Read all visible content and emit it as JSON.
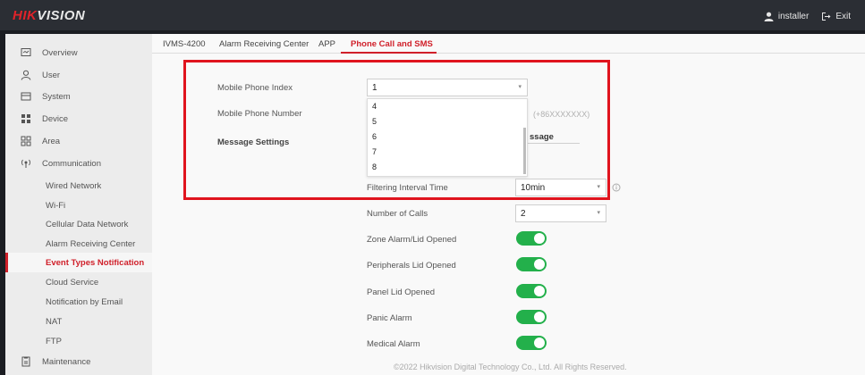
{
  "header": {
    "logo_part1": "HIK",
    "logo_part2": "VISION",
    "user_label": "installer",
    "exit_label": "Exit"
  },
  "sidebar": {
    "items": [
      {
        "label": "Overview",
        "icon": "overview-icon"
      },
      {
        "label": "User",
        "icon": "user-icon"
      },
      {
        "label": "System",
        "icon": "system-icon"
      },
      {
        "label": "Device",
        "icon": "device-icon"
      },
      {
        "label": "Area",
        "icon": "area-icon"
      },
      {
        "label": "Communication",
        "icon": "communication-icon"
      }
    ],
    "sub_items": [
      {
        "label": "Wired Network"
      },
      {
        "label": "Wi-Fi"
      },
      {
        "label": "Cellular Data Network"
      },
      {
        "label": "Alarm Receiving Center"
      },
      {
        "label": "Event Types Notification",
        "active": true
      },
      {
        "label": "Cloud Service"
      },
      {
        "label": "Notification by Email"
      },
      {
        "label": "NAT"
      },
      {
        "label": "FTP"
      }
    ],
    "maintenance": {
      "label": "Maintenance",
      "icon": "maintenance-icon"
    }
  },
  "tabs": [
    {
      "label": "IVMS-4200"
    },
    {
      "label": "Alarm Receiving Center"
    },
    {
      "label": "APP"
    },
    {
      "label": "Phone Call and SMS",
      "active": true
    }
  ],
  "form": {
    "mobile_phone_index_label": "Mobile Phone Index",
    "mobile_phone_index_value": "1",
    "mobile_phone_number_label": "Mobile Phone Number",
    "mobile_phone_number_hint": "(+86XXXXXXX)",
    "message_settings_label": "Message Settings",
    "message_settings_partial": "ssage",
    "dropdown_options": [
      "4",
      "5",
      "6",
      "7",
      "8"
    ],
    "filtering_interval_label": "Filtering Interval Time",
    "filtering_interval_value": "10min",
    "number_of_calls_label": "Number of Calls",
    "number_of_calls_value": "2",
    "toggles": [
      {
        "label": "Zone Alarm/Lid Opened",
        "on": true
      },
      {
        "label": "Peripherals Lid Opened",
        "on": true
      },
      {
        "label": "Panel Lid Opened",
        "on": true
      },
      {
        "label": "Panic Alarm",
        "on": true
      },
      {
        "label": "Medical Alarm",
        "on": true
      }
    ]
  },
  "footer": {
    "copyright": "©2022 Hikvision Digital Technology Co., Ltd. All Rights Reserved."
  },
  "colors": {
    "accent": "#d0202a",
    "toggle_on": "#23b04b",
    "highlight": "#e0141e"
  }
}
